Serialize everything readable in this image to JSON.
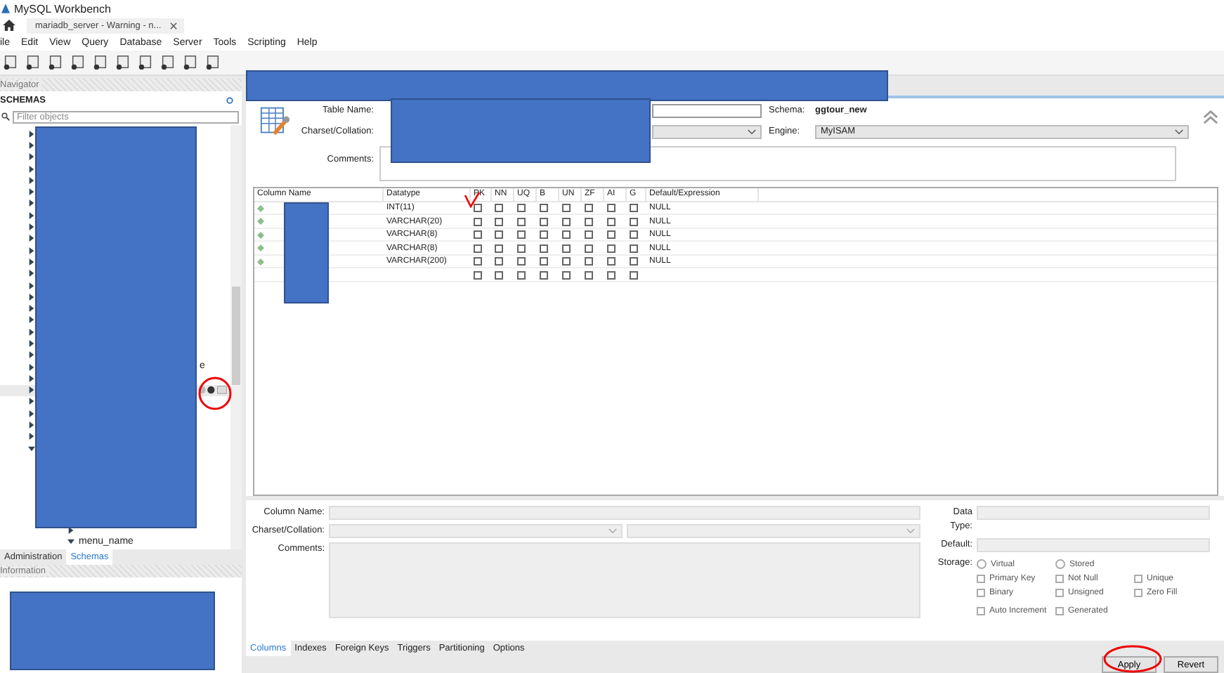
{
  "window": {
    "title": "MySQL Workbench"
  },
  "connection_tab": {
    "label": "mariadb_server - Warning - n..."
  },
  "menu": [
    "ile",
    "Edit",
    "View",
    "Query",
    "Database",
    "Server",
    "Tools",
    "Scripting",
    "Help"
  ],
  "navigator": {
    "title": "Navigator",
    "section": "SCHEMAS",
    "filter_placeholder": "Filter objects",
    "tree": [
      {
        "expanded": false,
        "selected": false
      },
      {
        "expanded": false,
        "selected": false
      },
      {
        "expanded": false,
        "selected": false
      },
      {
        "expanded": false,
        "selected": false
      },
      {
        "expanded": false,
        "selected": false
      },
      {
        "expanded": false,
        "selected": false
      },
      {
        "expanded": false,
        "selected": false
      },
      {
        "expanded": false,
        "selected": false
      },
      {
        "expanded": false,
        "selected": false
      },
      {
        "expanded": false,
        "selected": false
      },
      {
        "expanded": false,
        "selected": false
      },
      {
        "expanded": false,
        "selected": false
      },
      {
        "expanded": false,
        "selected": false
      },
      {
        "expanded": false,
        "selected": false
      },
      {
        "expanded": false,
        "selected": false
      },
      {
        "expanded": false,
        "selected": false
      },
      {
        "expanded": false,
        "selected": false
      },
      {
        "expanded": false,
        "selected": false
      },
      {
        "expanded": false,
        "selected": false
      },
      {
        "expanded": false,
        "selected": false
      },
      {
        "expanded": false,
        "selected": false,
        "label": "e"
      },
      {
        "expanded": false,
        "selected": false
      },
      {
        "expanded": false,
        "selected": true
      },
      {
        "expanded": false,
        "selected": false
      },
      {
        "expanded": false,
        "selected": false
      },
      {
        "expanded": false,
        "selected": false
      },
      {
        "expanded": false,
        "selected": false
      },
      {
        "expanded": true,
        "selected": false,
        "children": [
          {
            "expanded": false,
            "selected": false
          },
          {
            "expanded": false,
            "selected": false
          },
          {
            "expanded": false,
            "selected": false
          },
          {
            "expanded": false,
            "selected": false
          },
          {
            "expanded": false,
            "selected": false
          },
          {
            "expanded": false,
            "selected": false
          },
          {
            "expanded": false,
            "selected": false
          },
          {
            "expanded": true,
            "selected": false,
            "label": "menu_name"
          }
        ]
      }
    ],
    "tabs": [
      {
        "label": "Administration",
        "selected": false
      },
      {
        "label": "Schemas",
        "selected": true
      }
    ]
  },
  "information": {
    "title": "Information"
  },
  "table_editor": {
    "table_name_label": "Table Name:",
    "charset_label": "Charset/Collation:",
    "comments_label": "Comments:",
    "schema_label": "Schema:",
    "schema": "ggtour_new",
    "engine_label": "Engine:",
    "engine": "MyISAM",
    "columns": [
      "Column Name",
      "Datatype",
      "PK",
      "NN",
      "UQ",
      "B",
      "UN",
      "ZF",
      "AI",
      "G",
      "Default/Expression"
    ],
    "rows": [
      {
        "datatype": "INT(11)",
        "default": "NULL",
        "flags": [
          false,
          false,
          false,
          false,
          false,
          false,
          false,
          false
        ]
      },
      {
        "datatype": "VARCHAR(20)",
        "default": "NULL",
        "flags": [
          false,
          false,
          false,
          false,
          false,
          false,
          false,
          false
        ]
      },
      {
        "datatype": "VARCHAR(8)",
        "default": "NULL",
        "flags": [
          false,
          false,
          false,
          false,
          false,
          false,
          false,
          false
        ]
      },
      {
        "datatype": "VARCHAR(8)",
        "default": "NULL",
        "flags": [
          false,
          false,
          false,
          false,
          false,
          false,
          false,
          false
        ]
      },
      {
        "datatype": "VARCHAR(200)",
        "default": "NULL",
        "flags": [
          false,
          false,
          false,
          false,
          false,
          false,
          false,
          false
        ]
      },
      {
        "flags": [
          false,
          false,
          false,
          false,
          false,
          false,
          false,
          false
        ]
      }
    ]
  },
  "column_details": {
    "column_name_label": "Column Name:",
    "charset_label": "Charset/Collation:",
    "comments_label": "Comments:",
    "data_type_label": "Data Type:",
    "default_label": "Default:",
    "storage_label": "Storage:",
    "options": [
      [
        {
          "kind": "radio",
          "label": "Virtual",
          "checked": false
        },
        {
          "kind": "radio",
          "label": "Stored",
          "checked": false
        }
      ],
      [
        {
          "kind": "checkbox",
          "label": "Primary Key",
          "checked": false
        },
        {
          "kind": "checkbox",
          "label": "Not Null",
          "checked": false
        },
        {
          "kind": "checkbox",
          "label": "Unique",
          "checked": false
        }
      ],
      [
        {
          "kind": "checkbox",
          "label": "Binary",
          "checked": false
        },
        {
          "kind": "checkbox",
          "label": "Unsigned",
          "checked": false
        },
        {
          "kind": "checkbox",
          "label": "Zero Fill",
          "checked": false
        }
      ],
      [
        {
          "kind": "checkbox",
          "label": "Auto Increment",
          "checked": false
        },
        {
          "kind": "checkbox",
          "label": "Generated",
          "checked": false
        }
      ]
    ]
  },
  "editor_tabs": [
    {
      "label": "Columns",
      "selected": true
    },
    {
      "label": "Indexes",
      "selected": false
    },
    {
      "label": "Foreign Keys",
      "selected": false
    },
    {
      "label": "Triggers",
      "selected": false
    },
    {
      "label": "Partitioning",
      "selected": false
    },
    {
      "label": "Options",
      "selected": false
    }
  ],
  "buttons": [
    "Apply",
    "Revert"
  ]
}
